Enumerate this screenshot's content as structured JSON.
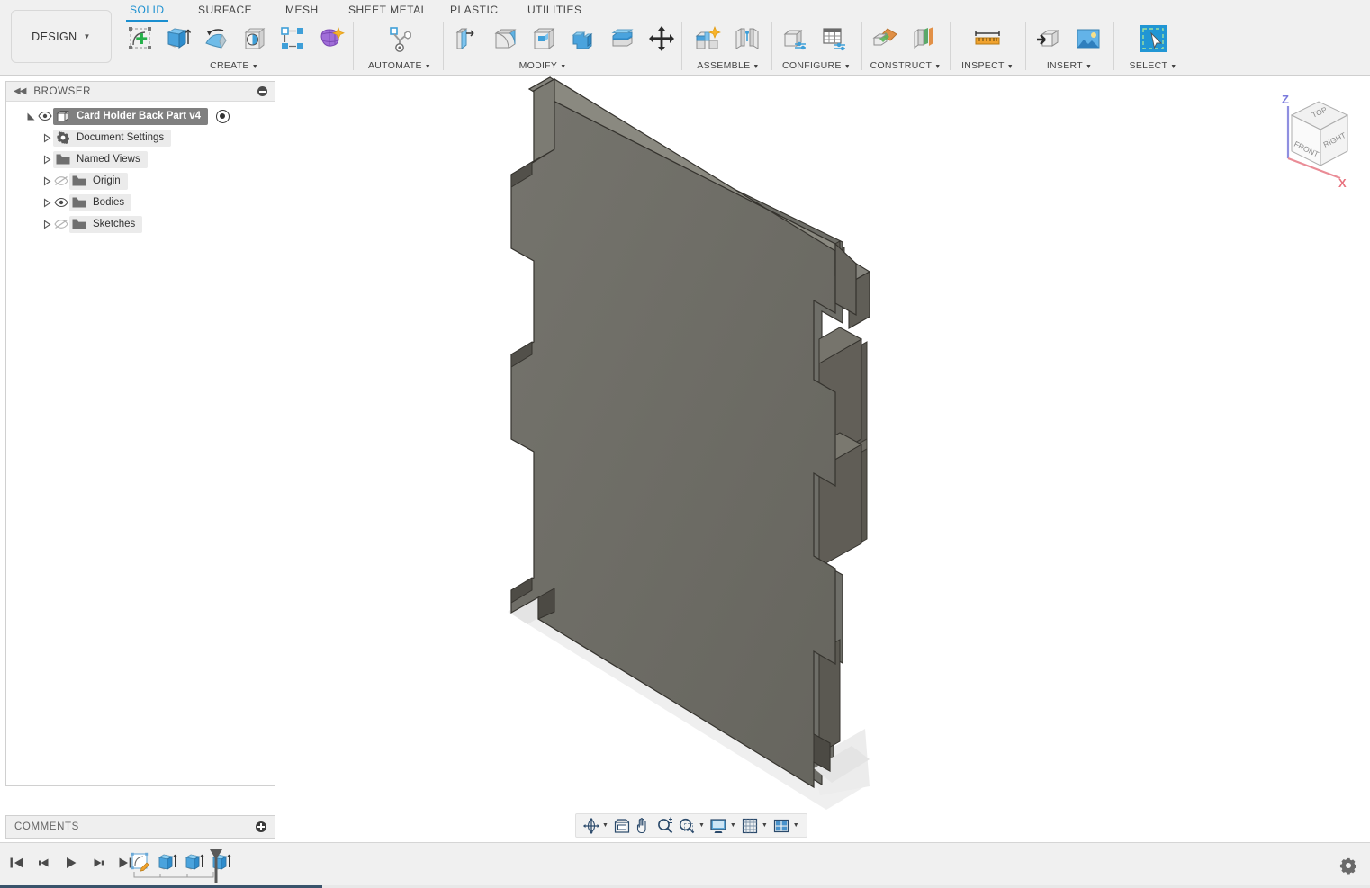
{
  "app": {
    "workspace_button": "DESIGN",
    "tabs": [
      {
        "label": "SOLID",
        "active": true
      },
      {
        "label": "SURFACE",
        "active": false
      },
      {
        "label": "MESH",
        "active": false
      },
      {
        "label": "SHEET METAL",
        "active": false
      },
      {
        "label": "PLASTIC",
        "active": false
      },
      {
        "label": "UTILITIES",
        "active": false
      }
    ],
    "accent_color": "#1a8fd0",
    "panel_bg": "#f0f0f0"
  },
  "toolbar_groups": [
    {
      "label": "CREATE",
      "has_caret": true,
      "icons": [
        "create-sketch-icon",
        "extrude-icon",
        "revolve-icon",
        "hole-icon",
        "rectangular-pattern-icon",
        "create-form-icon"
      ]
    },
    {
      "label": "AUTOMATE",
      "has_caret": true,
      "icons": [
        "automated-modeling-icon"
      ]
    },
    {
      "label": "MODIFY",
      "has_caret": true,
      "icons": [
        "press-pull-icon",
        "fillet-icon",
        "shell-icon",
        "combine-icon",
        "offset-face-icon",
        "move-copy-icon"
      ]
    },
    {
      "label": "ASSEMBLE",
      "has_caret": true,
      "icons": [
        "new-component-icon",
        "joint-icon"
      ]
    },
    {
      "label": "CONFIGURE",
      "has_caret": true,
      "icons": [
        "configuration-icon",
        "configuration-table-icon"
      ]
    },
    {
      "label": "CONSTRUCT",
      "has_caret": true,
      "icons": [
        "offset-plane-icon",
        "plane-three-points-icon"
      ]
    },
    {
      "label": "INSPECT",
      "has_caret": true,
      "icons": [
        "measure-icon"
      ]
    },
    {
      "label": "INSERT",
      "has_caret": true,
      "icons": [
        "insert-derive-icon",
        "insert-canvas-icon"
      ]
    },
    {
      "label": "SELECT",
      "has_caret": true,
      "icons": [
        "select-window-icon"
      ]
    }
  ],
  "browser": {
    "title": "BROWSER",
    "collapse_icon": "collapse-left-icon",
    "minimize_icon": "minus-circle-icon",
    "tree": [
      {
        "label": "Card Holder Back Part v4",
        "selected": true,
        "expanded": true,
        "visible": true,
        "icon": "component-cube-icon",
        "has_radio": true,
        "indent": 0
      },
      {
        "label": "Document Settings",
        "selected": false,
        "expanded": false,
        "visible": null,
        "icon": "gear-icon",
        "has_radio": false,
        "indent": 1
      },
      {
        "label": "Named Views",
        "selected": false,
        "expanded": false,
        "visible": null,
        "icon": "folder-icon",
        "has_radio": false,
        "indent": 1
      },
      {
        "label": "Origin",
        "selected": false,
        "expanded": false,
        "visible": false,
        "icon": "folder-icon",
        "has_radio": false,
        "indent": 1
      },
      {
        "label": "Bodies",
        "selected": false,
        "expanded": false,
        "visible": true,
        "icon": "folder-icon",
        "has_radio": false,
        "indent": 1
      },
      {
        "label": "Sketches",
        "selected": false,
        "expanded": false,
        "visible": false,
        "icon": "folder-icon",
        "has_radio": false,
        "indent": 1
      }
    ]
  },
  "comments": {
    "title": "COMMENTS",
    "add_icon": "plus-circle-icon"
  },
  "viewcube": {
    "faces": [
      "TOP",
      "FRONT",
      "RIGHT"
    ],
    "axes": [
      {
        "label": "Z",
        "color": "#7b7bdd"
      },
      {
        "label": "X",
        "color": "#e8737f"
      }
    ]
  },
  "navbar": {
    "items": [
      {
        "name": "orbit-icon",
        "caret": true
      },
      {
        "name": "look-at-icon",
        "caret": false
      },
      {
        "name": "pan-icon",
        "caret": false
      },
      {
        "name": "zoom-icon",
        "caret": false
      },
      {
        "name": "zoom-window-icon",
        "caret": true
      },
      {
        "name": "display-settings-icon",
        "caret": true
      },
      {
        "name": "grid-snaps-icon",
        "caret": true
      },
      {
        "name": "viewports-icon",
        "caret": true
      }
    ]
  },
  "timeline": {
    "controls": [
      "go-to-beginning-icon",
      "step-back-icon",
      "play-icon",
      "step-forward-icon",
      "go-to-end-icon"
    ],
    "features": [
      {
        "name": "sketch-feature-icon"
      },
      {
        "name": "extrude-feature-icon"
      },
      {
        "name": "extrude-feature-icon"
      },
      {
        "name": "extrude-feature-icon"
      }
    ],
    "marker": "timeline-marker",
    "settings_icon": "gear-icon"
  },
  "model": {
    "name": "Card Holder Back Part v4",
    "face_color": "#6e6e68",
    "edge_top_color": "#81807a",
    "side_color": "#56544e",
    "shadow_color": "#e0e0e0"
  }
}
